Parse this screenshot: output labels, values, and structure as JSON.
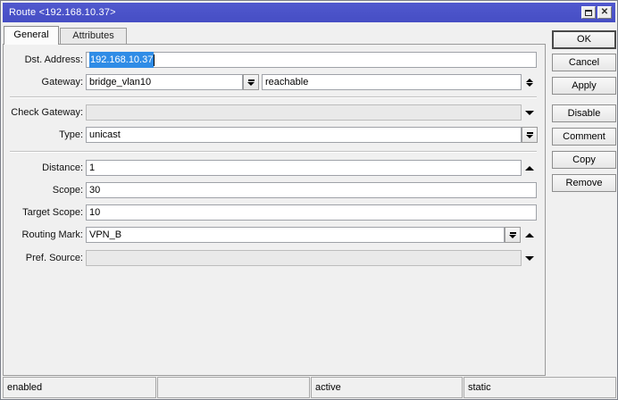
{
  "window": {
    "title": "Route <192.168.10.37>",
    "controls": {
      "maximize": "maximize",
      "close": "close"
    }
  },
  "tabs": {
    "general": {
      "label": "General",
      "active": true
    },
    "attributes": {
      "label": "Attributes",
      "active": false
    }
  },
  "fields": {
    "dst_address": {
      "label": "Dst. Address:",
      "value": "192.168.10.37",
      "selected": true
    },
    "gateway": {
      "label": "Gateway:",
      "value": "bridge_vlan10",
      "status": "reachable"
    },
    "check_gateway": {
      "label": "Check Gateway:",
      "value": "",
      "disabled": true
    },
    "type": {
      "label": "Type:",
      "value": "unicast"
    },
    "distance": {
      "label": "Distance:",
      "value": "1"
    },
    "scope": {
      "label": "Scope:",
      "value": "30"
    },
    "target_scope": {
      "label": "Target Scope:",
      "value": "10"
    },
    "routing_mark": {
      "label": "Routing Mark:",
      "value": "VPN_B"
    },
    "pref_source": {
      "label": "Pref. Source:",
      "value": "",
      "disabled": true
    }
  },
  "buttons": {
    "ok": "OK",
    "cancel": "Cancel",
    "apply": "Apply",
    "disable": "Disable",
    "comment": "Comment",
    "copy": "Copy",
    "remove": "Remove"
  },
  "statusbar": {
    "cells": [
      "enabled",
      "",
      "active",
      "static"
    ]
  },
  "colors": {
    "titlebar": "#4a52c8",
    "selection": "#2f8ce6",
    "dialog_bg": "#f0f0f0"
  }
}
